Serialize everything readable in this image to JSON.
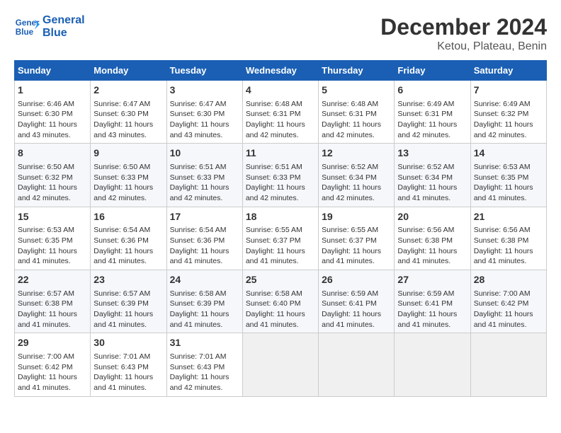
{
  "logo": {
    "line1": "General",
    "line2": "Blue"
  },
  "title": "December 2024",
  "subtitle": "Ketou, Plateau, Benin",
  "days_of_week": [
    "Sunday",
    "Monday",
    "Tuesday",
    "Wednesday",
    "Thursday",
    "Friday",
    "Saturday"
  ],
  "weeks": [
    [
      {
        "day": "1",
        "sunrise": "6:46 AM",
        "sunset": "6:30 PM",
        "daylight": "11 hours and 43 minutes."
      },
      {
        "day": "2",
        "sunrise": "6:47 AM",
        "sunset": "6:30 PM",
        "daylight": "11 hours and 43 minutes."
      },
      {
        "day": "3",
        "sunrise": "6:47 AM",
        "sunset": "6:30 PM",
        "daylight": "11 hours and 43 minutes."
      },
      {
        "day": "4",
        "sunrise": "6:48 AM",
        "sunset": "6:31 PM",
        "daylight": "11 hours and 42 minutes."
      },
      {
        "day": "5",
        "sunrise": "6:48 AM",
        "sunset": "6:31 PM",
        "daylight": "11 hours and 42 minutes."
      },
      {
        "day": "6",
        "sunrise": "6:49 AM",
        "sunset": "6:31 PM",
        "daylight": "11 hours and 42 minutes."
      },
      {
        "day": "7",
        "sunrise": "6:49 AM",
        "sunset": "6:32 PM",
        "daylight": "11 hours and 42 minutes."
      }
    ],
    [
      {
        "day": "8",
        "sunrise": "6:50 AM",
        "sunset": "6:32 PM",
        "daylight": "11 hours and 42 minutes."
      },
      {
        "day": "9",
        "sunrise": "6:50 AM",
        "sunset": "6:33 PM",
        "daylight": "11 hours and 42 minutes."
      },
      {
        "day": "10",
        "sunrise": "6:51 AM",
        "sunset": "6:33 PM",
        "daylight": "11 hours and 42 minutes."
      },
      {
        "day": "11",
        "sunrise": "6:51 AM",
        "sunset": "6:33 PM",
        "daylight": "11 hours and 42 minutes."
      },
      {
        "day": "12",
        "sunrise": "6:52 AM",
        "sunset": "6:34 PM",
        "daylight": "11 hours and 42 minutes."
      },
      {
        "day": "13",
        "sunrise": "6:52 AM",
        "sunset": "6:34 PM",
        "daylight": "11 hours and 41 minutes."
      },
      {
        "day": "14",
        "sunrise": "6:53 AM",
        "sunset": "6:35 PM",
        "daylight": "11 hours and 41 minutes."
      }
    ],
    [
      {
        "day": "15",
        "sunrise": "6:53 AM",
        "sunset": "6:35 PM",
        "daylight": "11 hours and 41 minutes."
      },
      {
        "day": "16",
        "sunrise": "6:54 AM",
        "sunset": "6:36 PM",
        "daylight": "11 hours and 41 minutes."
      },
      {
        "day": "17",
        "sunrise": "6:54 AM",
        "sunset": "6:36 PM",
        "daylight": "11 hours and 41 minutes."
      },
      {
        "day": "18",
        "sunrise": "6:55 AM",
        "sunset": "6:37 PM",
        "daylight": "11 hours and 41 minutes."
      },
      {
        "day": "19",
        "sunrise": "6:55 AM",
        "sunset": "6:37 PM",
        "daylight": "11 hours and 41 minutes."
      },
      {
        "day": "20",
        "sunrise": "6:56 AM",
        "sunset": "6:38 PM",
        "daylight": "11 hours and 41 minutes."
      },
      {
        "day": "21",
        "sunrise": "6:56 AM",
        "sunset": "6:38 PM",
        "daylight": "11 hours and 41 minutes."
      }
    ],
    [
      {
        "day": "22",
        "sunrise": "6:57 AM",
        "sunset": "6:38 PM",
        "daylight": "11 hours and 41 minutes."
      },
      {
        "day": "23",
        "sunrise": "6:57 AM",
        "sunset": "6:39 PM",
        "daylight": "11 hours and 41 minutes."
      },
      {
        "day": "24",
        "sunrise": "6:58 AM",
        "sunset": "6:39 PM",
        "daylight": "11 hours and 41 minutes."
      },
      {
        "day": "25",
        "sunrise": "6:58 AM",
        "sunset": "6:40 PM",
        "daylight": "11 hours and 41 minutes."
      },
      {
        "day": "26",
        "sunrise": "6:59 AM",
        "sunset": "6:41 PM",
        "daylight": "11 hours and 41 minutes."
      },
      {
        "day": "27",
        "sunrise": "6:59 AM",
        "sunset": "6:41 PM",
        "daylight": "11 hours and 41 minutes."
      },
      {
        "day": "28",
        "sunrise": "7:00 AM",
        "sunset": "6:42 PM",
        "daylight": "11 hours and 41 minutes."
      }
    ],
    [
      {
        "day": "29",
        "sunrise": "7:00 AM",
        "sunset": "6:42 PM",
        "daylight": "11 hours and 41 minutes."
      },
      {
        "day": "30",
        "sunrise": "7:01 AM",
        "sunset": "6:43 PM",
        "daylight": "11 hours and 41 minutes."
      },
      {
        "day": "31",
        "sunrise": "7:01 AM",
        "sunset": "6:43 PM",
        "daylight": "11 hours and 42 minutes."
      },
      null,
      null,
      null,
      null
    ]
  ],
  "labels": {
    "sunrise": "Sunrise:",
    "sunset": "Sunset:",
    "daylight": "Daylight:"
  }
}
